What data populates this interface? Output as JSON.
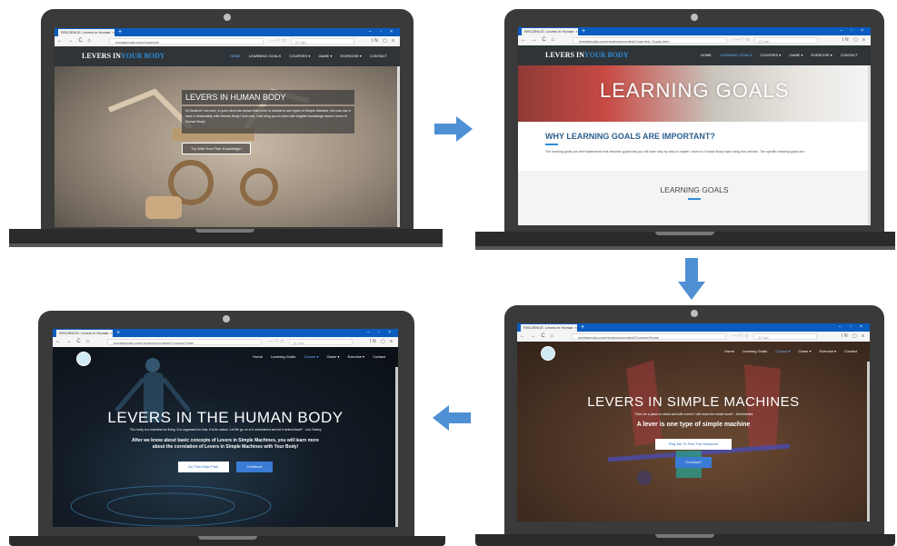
{
  "browser": {
    "tab_title": "RISCIENCE: Levers in Human: ×",
    "window_controls": "– ▫ ×",
    "search_placeholder": "Q  Cari",
    "nav_buttons": "← → C ⌂",
    "url_icons": "··· ♡ ☆",
    "right_icons": "IN ▢ ≡"
  },
  "screens": {
    "home": {
      "url": "mediaenglia.com/riscience/",
      "logo_part1": "LEVERS IN",
      "logo_part2": "YOUR BODY",
      "menu": [
        "HOME",
        "LEARNING GOALS",
        "COURSES ▾",
        "GAME ▾",
        "EXERCISE ▾",
        "CONTACT"
      ],
      "hero_title": "LEVERS IN HUMAN BODY",
      "hero_text": "Hi Student! I am sure, in your mind has known that Lever is include in one types of Simple Machine, but how can it have a relationship with Human Body? And now, I will bring you to learn with brighter knowledge about Levers in Human Body!",
      "hero_button": "Try With Your Prior Knowledge!"
    },
    "learning_goals": {
      "url": "mediaenglia.com/riscience/content/Learning_Goals.html",
      "logo_part1": "LEVERS IN",
      "logo_part2": "YOUR BODY",
      "menu": [
        "HOME",
        "LEARNING GOALS",
        "COURSES ▾",
        "GAME ▾",
        "EXERCISE ▾",
        "CONTACT"
      ],
      "banner_title": "LEARNING GOALS",
      "section_title": "WHY LEARNING GOALS ARE IMPORTANT?",
      "section_text": "The learning goals are brief statements that describe goals that you will learn step by step to master Levers in Human Body topic using this website. The specific learning goals are:",
      "subsection_title": "LEARNING GOALS"
    },
    "simple_machines": {
      "url": "mediaenglia.com/riscience/content/Courses/Home",
      "menu": [
        "Home",
        "Learning Goals",
        "Course ▾",
        "Game ▾",
        "Exercise ▾",
        "Contact"
      ],
      "title": "LEVERS IN SIMPLE MACHINES",
      "quote": "\"Give me a place to stand and with a lever I will move the whole world\" - Archimedes",
      "subtitle": "A lever is one type of simple machine",
      "button1": "Play Me To Find The Keyword!",
      "button2": "Continue!"
    },
    "human_body": {
      "url": "mediaenglia.com/riscience/content/Courses/Other",
      "menu": [
        "Home",
        "Learning Goals",
        "Course ▾",
        "Game ▾",
        "Exercise ▾",
        "Contact"
      ],
      "title": "LEVERS IN THE HUMAN BODY",
      "quote": "\"Our body is a machine for living. It is organized for that, it is its nature. Let life go on in it unhindered and let it defend itself\" - Leo Tolstoy",
      "text": "After we know about basic concepts of Levers in Simple Machines, you will learn more about the correlation of Levers in Simple Machines with Your Body!",
      "button1": "Do This Step First!",
      "button2": "Continue!"
    }
  },
  "colors": {
    "laptop": "#3a3a3a",
    "tabbar": "#0b5cbf",
    "arrow": "#4f8fd4",
    "accent": "#2d8bd6"
  }
}
